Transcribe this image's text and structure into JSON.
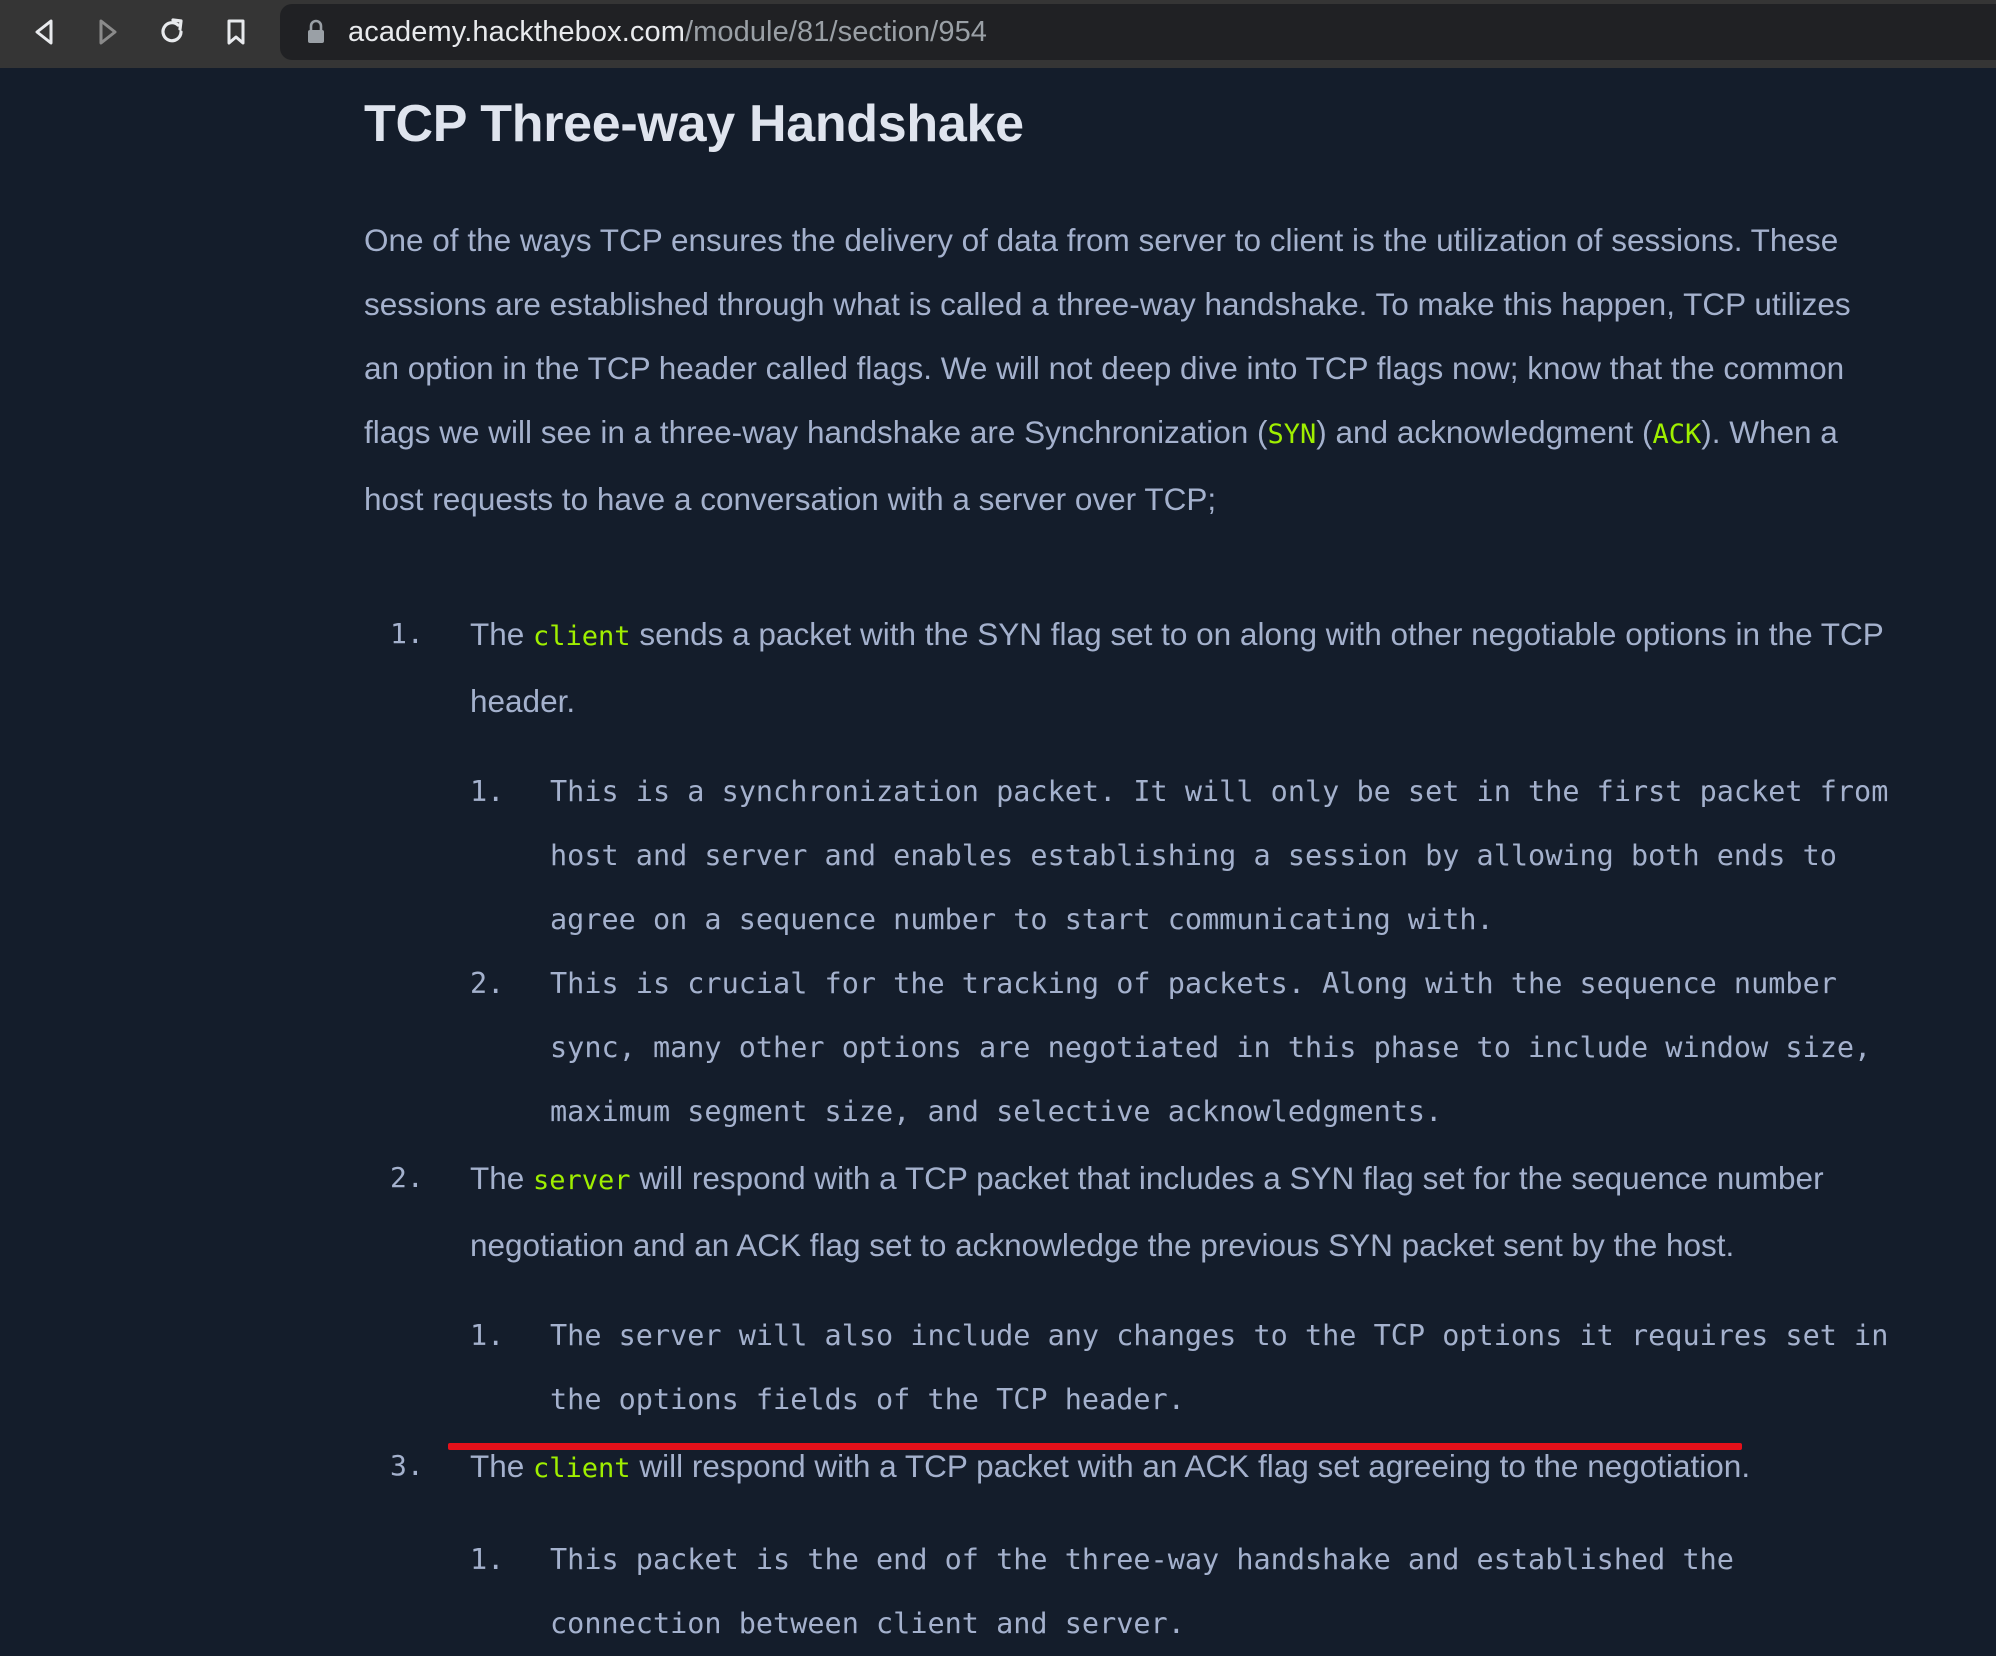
{
  "browser": {
    "url_host": "academy.hackthebox.com",
    "url_path": "/module/81/section/954",
    "icons": [
      "back-icon",
      "forward-icon",
      "reload-icon",
      "bookmark-icon",
      "lock-icon"
    ]
  },
  "colors": {
    "background": "#141d2b",
    "text": "#a4b1cd",
    "title": "#dfe4ee",
    "highlight": "#9fef00",
    "annotation": "#e5101a"
  },
  "article": {
    "title": "TCP Three-way Handshake",
    "intro_part1": "One of the ways TCP ensures the delivery of data from server to client is the utilization of sessions. These sessions are established through what is called a three-way handshake. To make this happen, TCP utilizes an option in the TCP header called flags. We will not deep dive into TCP flags now; know that the common flags we will see in a three-way handshake are Synchronization (",
    "intro_code1": "SYN",
    "intro_part2": ") and acknowledgment (",
    "intro_code2": "ACK",
    "intro_part3": "). When a host requests to have a conversation with a server over TCP;",
    "steps": [
      {
        "num": "1.",
        "pre": "The ",
        "code": "client",
        "post": " sends a packet with the SYN flag set to on along with other negotiable options in the TCP header.",
        "subs": [
          {
            "num": "1.",
            "text": "This is a synchronization packet. It will only be set in the first packet from host and server and enables establishing a session by allowing both ends to agree on a sequence number to start communicating with."
          },
          {
            "num": "2.",
            "text": "This is crucial for the tracking of packets. Along with the sequence number sync, many other options are negotiated in this phase to include window size, maximum segment size, and selective acknowledgments."
          }
        ]
      },
      {
        "num": "2.",
        "pre": "The ",
        "code": "server",
        "post": " will respond with a TCP packet that includes a SYN flag set for the sequence number negotiation and an ACK flag set to acknowledge the previous SYN packet sent by the host.",
        "subs": [
          {
            "num": "1.",
            "text": "The server will also include any changes to the TCP options it requires set in the options fields of the TCP header."
          }
        ]
      },
      {
        "num": "3.",
        "pre": "The ",
        "code": "client",
        "post": " will respond with a TCP packet with an ACK flag set agreeing to the negotiation.",
        "subs": [
          {
            "num": "1.",
            "text": "This packet is the end of the three-way handshake and established the connection between client and server."
          }
        ]
      }
    ]
  }
}
